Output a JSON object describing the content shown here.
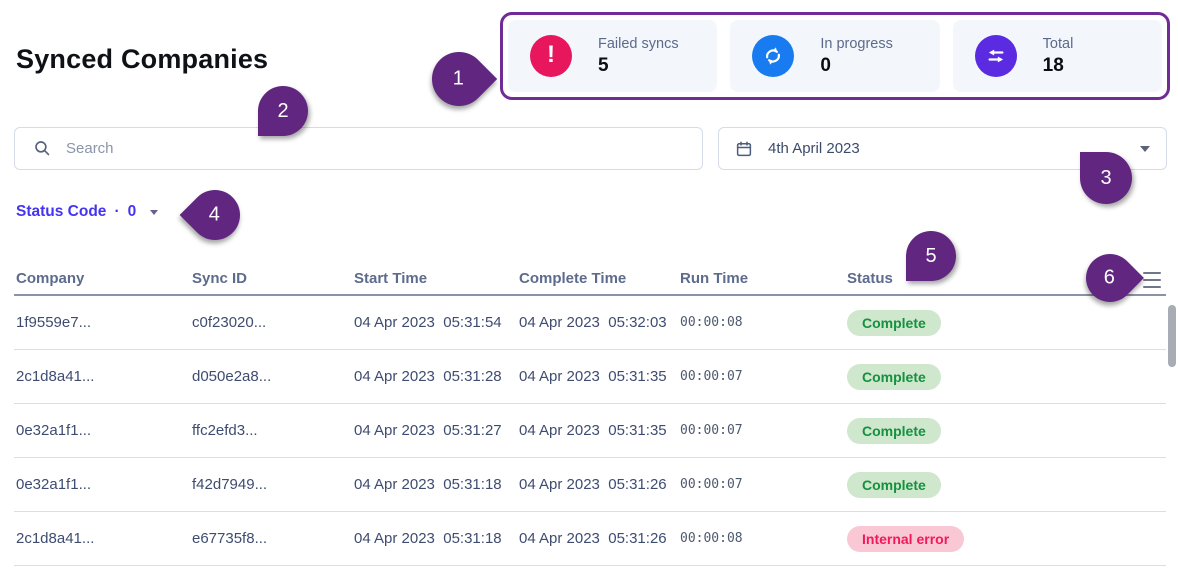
{
  "page": {
    "title": "Synced Companies"
  },
  "stats": {
    "cards": [
      {
        "label": "Failed syncs",
        "value": "5",
        "icon": "alert-circle-icon",
        "color": "#e8175d"
      },
      {
        "label": "In progress",
        "value": "0",
        "icon": "sync-icon",
        "color": "#187bf0"
      },
      {
        "label": "Total",
        "value": "18",
        "icon": "transfer-arrows-icon",
        "color": "#5a2be0"
      }
    ]
  },
  "search": {
    "placeholder": "Search"
  },
  "date_picker": {
    "value": "4th April 2023"
  },
  "filter": {
    "label": "Status Code",
    "separator": "·",
    "count": "0"
  },
  "table": {
    "columns": [
      "Company",
      "Sync ID",
      "Start Time",
      "Complete Time",
      "Run Time",
      "Status"
    ],
    "rows": [
      {
        "company": "1f9559e7...",
        "sync_id": "c0f23020...",
        "start_time": "04 Apr 2023  05:31:54",
        "complete_time": "04 Apr 2023  05:32:03",
        "run_time": "00:00:08",
        "status": "Complete",
        "status_type": "success"
      },
      {
        "company": "2c1d8a41...",
        "sync_id": "d050e2a8...",
        "start_time": "04 Apr 2023  05:31:28",
        "complete_time": "04 Apr 2023  05:31:35",
        "run_time": "00:00:07",
        "status": "Complete",
        "status_type": "success"
      },
      {
        "company": "0e32a1f1...",
        "sync_id": "ffc2efd3...",
        "start_time": "04 Apr 2023  05:31:27",
        "complete_time": "04 Apr 2023  05:31:35",
        "run_time": "00:00:07",
        "status": "Complete",
        "status_type": "success"
      },
      {
        "company": "0e32a1f1...",
        "sync_id": "f42d7949...",
        "start_time": "04 Apr 2023  05:31:18",
        "complete_time": "04 Apr 2023  05:31:26",
        "run_time": "00:00:07",
        "status": "Complete",
        "status_type": "success"
      },
      {
        "company": "2c1d8a41...",
        "sync_id": "e67735f8...",
        "start_time": "04 Apr 2023  05:31:18",
        "complete_time": "04 Apr 2023  05:31:26",
        "run_time": "00:00:08",
        "status": "Internal error",
        "status_type": "error"
      }
    ]
  },
  "callouts": [
    "1",
    "2",
    "3",
    "4",
    "5",
    "6"
  ],
  "icons": {
    "search": "search-icon",
    "date": "calendar-icon",
    "dropdown": "caret-down-icon",
    "table_menu": "hamburger-menu-icon"
  },
  "colors": {
    "callout_purple": "#61267f",
    "panel_border": "#6f2b96",
    "failed_red": "#e8175d",
    "progress_blue": "#187bf0",
    "total_indigo": "#5a2be0",
    "filter_blue": "#4434f2",
    "pill_success_bg": "#cfe7cd",
    "pill_success_text": "#159140",
    "pill_error_bg": "#f9c8d4",
    "pill_error_text": "#f1195a"
  }
}
